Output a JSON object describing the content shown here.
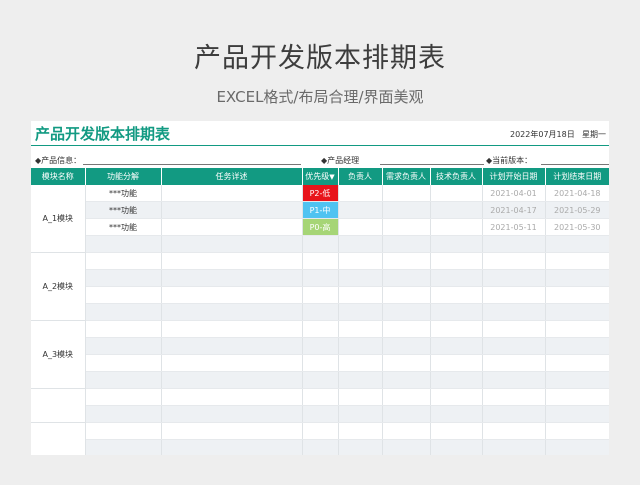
{
  "header": {
    "title": "产品开发版本排期表",
    "subtitle": "EXCEL格式/布局合理/界面美观"
  },
  "sheet": {
    "title": "产品开发版本排期表",
    "date": "2022年07月18日",
    "weekday": "星期一",
    "info": {
      "product_info_label": "◆产品信息：",
      "product_manager_label": "◆产品经理",
      "current_version_label": "◆当前版本："
    },
    "columns": [
      "模块名称",
      "功能分解",
      "任务详述",
      "优先级",
      "负责人",
      "需求负责人",
      "技术负责人",
      "计划开始日期",
      "计划结束日期"
    ],
    "sort_arrow": "▼",
    "modules": [
      {
        "name": "A_1模块",
        "rows": [
          {
            "feature": "***功能",
            "task": "",
            "priority": "P2-低",
            "priority_color": "#e8141b",
            "owner": "",
            "req_owner": "",
            "tech_owner": "",
            "start": "2021-04-01",
            "end": "2021-04-18"
          },
          {
            "feature": "***功能",
            "task": "",
            "priority": "P1-中",
            "priority_color": "#4fc3f1",
            "owner": "",
            "req_owner": "",
            "tech_owner": "",
            "start": "2021-04-17",
            "end": "2021-05-29"
          },
          {
            "feature": "***功能",
            "task": "",
            "priority": "P0-高",
            "priority_color": "#a6d576",
            "owner": "",
            "req_owner": "",
            "tech_owner": "",
            "start": "2021-05-11",
            "end": "2021-05-30"
          }
        ]
      },
      {
        "name": "A_2模块"
      },
      {
        "name": "A_3模块"
      },
      {
        "name": ""
      },
      {
        "name": ""
      }
    ]
  },
  "colors": {
    "accent": "#129a82",
    "row_alt": "#eef1f4"
  }
}
